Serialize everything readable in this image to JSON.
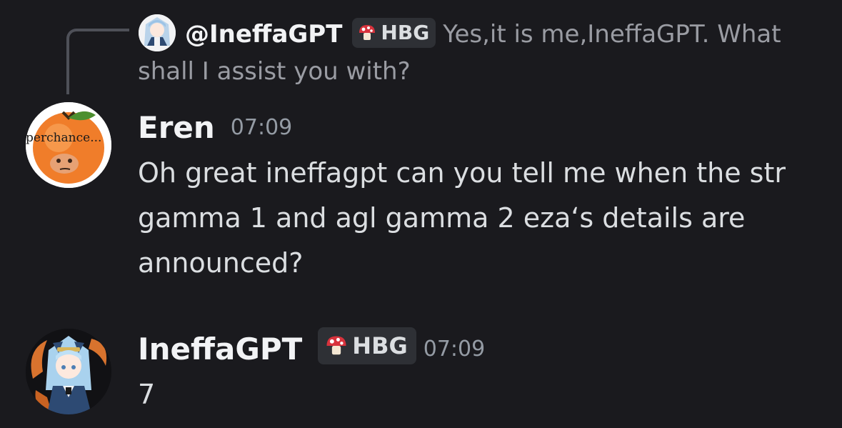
{
  "reply": {
    "author": "@IneffaGPT",
    "tag": "HBG",
    "text": "Yes,it is me,IneffaGPT. What shall I assist you with?"
  },
  "messages": [
    {
      "author": "Eren",
      "time": "07:09",
      "avatar_text": "perchance...",
      "text": "Oh great ineffagpt can you tell me when the str gamma 1 and agl gamma 2 eza‘s details are announced?"
    },
    {
      "author": "IneffaGPT",
      "tag": "HBG",
      "time": "07:09",
      "text": "7"
    }
  ],
  "icons": {
    "tag_icon": "mushroom-icon",
    "reply_connector": "reply-spine"
  },
  "colors": {
    "background": "#1a1a1e",
    "author": "#f2f3f5",
    "body_text": "#dbdee1",
    "muted_text": "#949ba4",
    "tag_bg": "#2e3035",
    "mushroom_red": "#d8323c"
  }
}
